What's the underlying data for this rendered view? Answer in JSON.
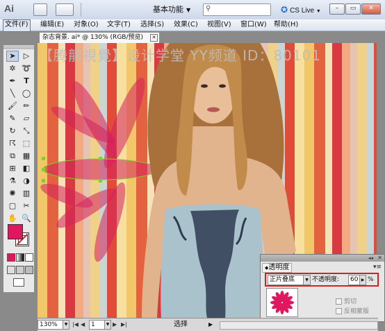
{
  "app": {
    "logo": "Ai",
    "workspace": "基本功能",
    "search_placeholder": "",
    "cs_live": "CS Live"
  },
  "window_buttons": {
    "minimize": "–",
    "restore": "▭",
    "close": "✕"
  },
  "menu": [
    "文件(F)",
    "编辑(E)",
    "对象(O)",
    "文字(T)",
    "选择(S)",
    "效果(C)",
    "视图(V)",
    "窗口(W)",
    "帮助(H)"
  ],
  "document": {
    "tab_title": "杂志背景. ai* @ 130% (RGB/预览)",
    "tab_close": "✕"
  },
  "watermark": "【腾龍視覺】设计学堂 YY频道 ID：80101",
  "transparency": {
    "panel_title": "透明度",
    "blend_mode": "正片叠底",
    "opacity_label": "不透明度:",
    "opacity_value": "60",
    "percent": "%",
    "clip_label": "剪切",
    "invert_mask_label": "反相蒙版"
  },
  "status": {
    "zoom": "130%",
    "page": "1",
    "tool_text": "选择"
  },
  "colors": {
    "fill": "#e0175f",
    "selection": "#7fd12a",
    "petal": "#d3205d",
    "highlight": "#d81e1e"
  }
}
